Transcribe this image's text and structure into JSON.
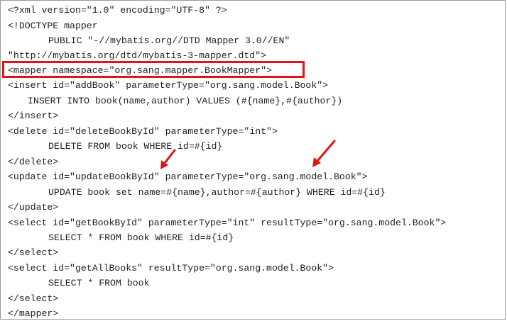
{
  "lines": [
    "<?xml version=\"1.0\" encoding=\"UTF-8\" ?>",
    "<!DOCTYPE mapper",
    "PUBLIC \"-//mybatis.org//DTD Mapper 3.0//EN\"",
    "\"http://mybatis.org/dtd/mybatis-3-mapper.dtd\">",
    "<mapper namespace=\"org.sang.mapper.BookMapper\">",
    "<insert id=\"addBook\" parameterType=\"org.sang.model.Book\">",
    "INSERT INTO book(name,author) VALUES (#{name},#{author})",
    "</insert>",
    "<delete id=\"deleteBookById\" parameterType=\"int\">",
    "DELETE FROM book WHERE id=#{id}",
    "</delete>",
    "<update id=\"updateBookById\" parameterType=\"org.sang.model.Book\">",
    "UPDATE book set name=#{name},author=#{author} WHERE id=#{id}",
    "</update>",
    "<select id=\"getBookById\" parameterType=\"int\" resultType=\"org.sang.model.Book\">",
    "SELECT * FROM book WHERE id=#{id}",
    "</select>",
    "<select id=\"getAllBooks\" resultType=\"org.sang.model.Book\">",
    "SELECT * FROM book",
    "</select>",
    "</mapper>"
  ],
  "annotation_color": "#e01515",
  "text_color": "#1f1f1f"
}
